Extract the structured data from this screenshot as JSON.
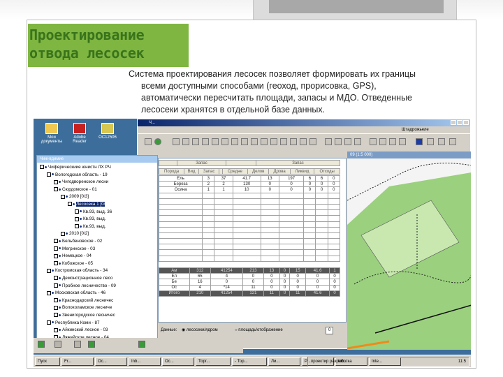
{
  "slide": {
    "title_line1": "Проектирование",
    "title_line2": "отвода лесосек",
    "description": [
      "Система проектирования лесосек позволяет формировать их границы",
      "всеми доступными способами (геоход, прорисовка, GPS),",
      "автоматически пересчитать площади, запасы и МДО. Отведенные",
      "лесосеки хранятся в отдельной базе данных."
    ]
  },
  "colors": {
    "title_green": "#39741c",
    "title_bg": "#7fb641",
    "desktop_blue": "#3d6e9b",
    "map_green": "#9bd07f"
  },
  "desktop_icons": [
    {
      "label": "Мои документы",
      "icon": "folder-icon"
    },
    {
      "label": "Adobe Reader",
      "icon": "pdf-icon"
    },
    {
      "label": "ОС12506",
      "icon": "app-icon"
    }
  ],
  "app": {
    "toolbar_right_label": "Штадрожьеле",
    "tree_title": "Чиж-вдимие",
    "map_title": "09 (1:5 000)"
  },
  "tree": [
    {
      "label": "Чиферическиие юнистн ЛХ РЧ",
      "level": 0
    },
    {
      "label": "Вологодская область - 19",
      "level": 1
    },
    {
      "label": "Чигодворенское лесни",
      "level": 2
    },
    {
      "label": "Сюрдомское - 01",
      "level": 2
    },
    {
      "label": "2009 [0/3]",
      "level": 3
    },
    {
      "label": "Лесосека 1 [0/",
      "level": 4,
      "selected": true
    },
    {
      "label": "Кв.93, выд. 36",
      "level": 5
    },
    {
      "label": "Кв.93, выд.",
      "level": 5
    },
    {
      "label": "Кв.93, выд.",
      "level": 5
    },
    {
      "label": "2010 [0/2]",
      "level": 3
    },
    {
      "label": "Бельбеновское - 02",
      "level": 2
    },
    {
      "label": "Мегринское - 03",
      "level": 2
    },
    {
      "label": "Немецкое - 04",
      "level": 2
    },
    {
      "label": "Кобожское - 05",
      "level": 2
    },
    {
      "label": "Костромская область - 34",
      "level": 1
    },
    {
      "label": "Демонстрационное лесо",
      "level": 2
    },
    {
      "label": "Пробное лесничество - 09",
      "level": 2
    },
    {
      "label": "Московская область - 46",
      "level": 1
    },
    {
      "label": "Краснодарский лесничес",
      "level": 2
    },
    {
      "label": "Волоколамское лесниче",
      "level": 2
    },
    {
      "label": "Звенигородское лесничес",
      "level": 2
    },
    {
      "label": "Республика Коми - 87",
      "level": 1
    },
    {
      "label": "Айкинский лесное - 03",
      "level": 2
    },
    {
      "label": "Ляжейское лесное - 04",
      "level": 2
    }
  ],
  "table": {
    "header_top": [
      "",
      "Запас",
      "",
      "Запас"
    ],
    "header": [
      "Порода",
      "Вид",
      "Запас",
      "",
      "Средне",
      "Делов",
      "Дрова",
      "Ликвид",
      "Отходы"
    ],
    "rows": [
      [
        "Ель",
        "3",
        "37",
        "41.7",
        "13",
        "197",
        "6",
        "6",
        "0"
      ],
      [
        "Береза",
        "2",
        "2",
        "130",
        "0",
        "0",
        "0",
        "0",
        "0"
      ],
      [
        "Осина",
        "1",
        "1",
        "10",
        "0",
        "0",
        "0",
        "0",
        "0"
      ]
    ],
    "summary_header": [
      "Ам",
      "312",
      "41254",
      "213",
      "13",
      "0",
      "15",
      "41.6",
      "1"
    ],
    "summary_rows": [
      [
        "Ел",
        "65",
        "4",
        "0",
        "0",
        "0",
        "0",
        "0",
        "0"
      ],
      [
        "Бе",
        "16",
        "0",
        "0",
        "0",
        "0",
        "0",
        "0",
        "0"
      ],
      [
        "Ос",
        "4",
        "*14",
        "11",
        "0",
        "0",
        "0",
        "0",
        "0"
      ]
    ],
    "summary_total": [
      "Итого",
      "210",
      "41254",
      "121",
      "11",
      "0",
      "11",
      "41.6",
      "0"
    ]
  },
  "status": {
    "label": "Данные:",
    "option1": "лесосеки/ядром",
    "option2": "площадь/отображение",
    "value": "0"
  },
  "taskbar": [
    "Пуск",
    "Fr...",
    "Oc...",
    "Inb...",
    "Ос...",
    "Торг...",
    "- Тор...",
    "Ли...",
    "Pl...",
    "Inb...",
    "Inte..."
  ],
  "tray": {
    "text": "проектир разработка",
    "clock": "11:5"
  }
}
